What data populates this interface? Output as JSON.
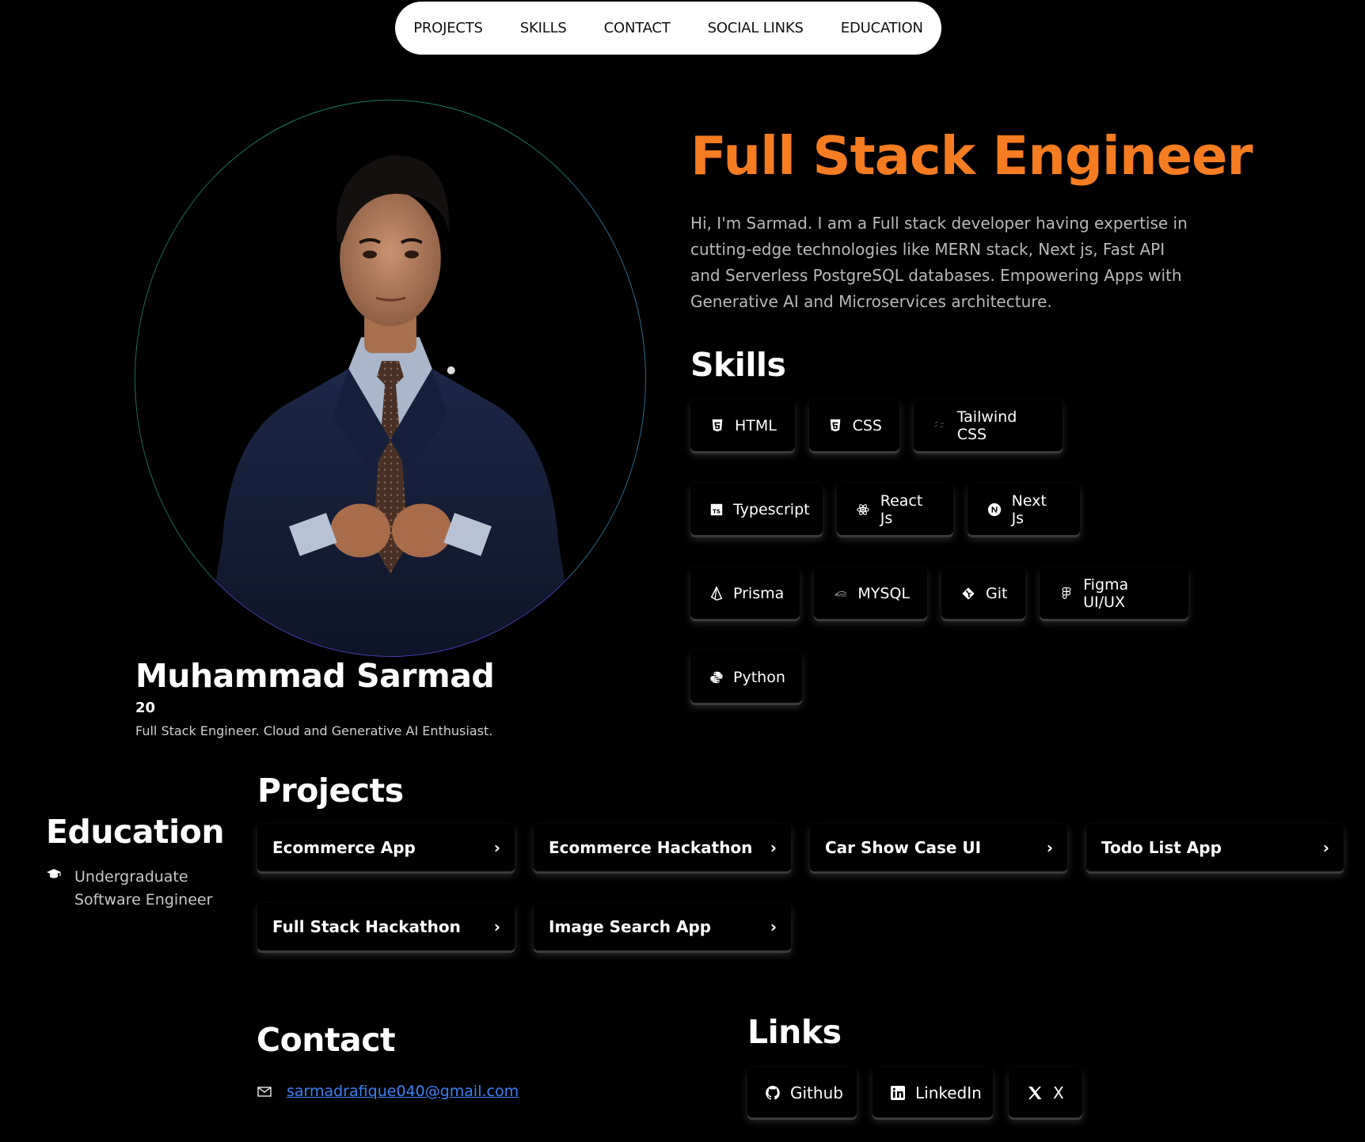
{
  "nav": {
    "items": [
      {
        "label": "PROJECTS"
      },
      {
        "label": "SKILLS"
      },
      {
        "label": "CONTACT"
      },
      {
        "label": "SOCIAL LINKS"
      },
      {
        "label": "EDUCATION"
      }
    ]
  },
  "profile": {
    "name": "Muhammad Sarmad",
    "age": "20",
    "tagline": "Full Stack Engineer. Cloud and Generative AI Enthusiast."
  },
  "hero": {
    "title": "Full Stack Engineer",
    "description": "Hi, I'm Sarmad. I am a Full stack developer having expertise in cutting-edge technologies like MERN stack, Next js, Fast API and Serverless PostgreSQL databases. Empowering Apps with Generative AI and Microservices architecture."
  },
  "skills": {
    "heading": "Skills",
    "items": [
      {
        "label": "HTML",
        "icon": "html5-icon"
      },
      {
        "label": "CSS",
        "icon": "css3-icon"
      },
      {
        "label": "Tailwind CSS",
        "icon": "tailwind-icon"
      },
      {
        "label": "Typescript",
        "icon": "typescript-icon"
      },
      {
        "label": "React Js",
        "icon": "react-icon"
      },
      {
        "label": "Next Js",
        "icon": "nextjs-icon"
      },
      {
        "label": "Prisma",
        "icon": "prisma-icon"
      },
      {
        "label": "MYSQL",
        "icon": "mysql-icon"
      },
      {
        "label": "Git",
        "icon": "git-icon"
      },
      {
        "label": "Figma UI/UX",
        "icon": "figma-icon"
      },
      {
        "label": "Python",
        "icon": "python-icon"
      }
    ]
  },
  "education": {
    "heading": "Education",
    "line1": "Undergraduate",
    "line2": "Software Engineer",
    "icon": "graduation-cap-icon"
  },
  "projects": {
    "heading": "Projects",
    "items": [
      {
        "label": "Ecommerce App"
      },
      {
        "label": "Ecommerce Hackathon"
      },
      {
        "label": "Car Show Case UI"
      },
      {
        "label": "Todo List App"
      },
      {
        "label": "Full Stack Hackathon"
      },
      {
        "label": "Image Search App"
      }
    ],
    "chevron": "›"
  },
  "contact": {
    "heading": "Contact",
    "email": "sarmadrafique040@gmail.com",
    "icon": "mail-icon"
  },
  "links": {
    "heading": "Links",
    "items": [
      {
        "label": "Github",
        "icon": "github-icon"
      },
      {
        "label": "LinkedIn",
        "icon": "linkedin-icon"
      },
      {
        "label": "X",
        "icon": "x-icon"
      }
    ]
  },
  "colors": {
    "accent": "#f57c20",
    "link": "#3b82f6",
    "background": "#000000"
  }
}
